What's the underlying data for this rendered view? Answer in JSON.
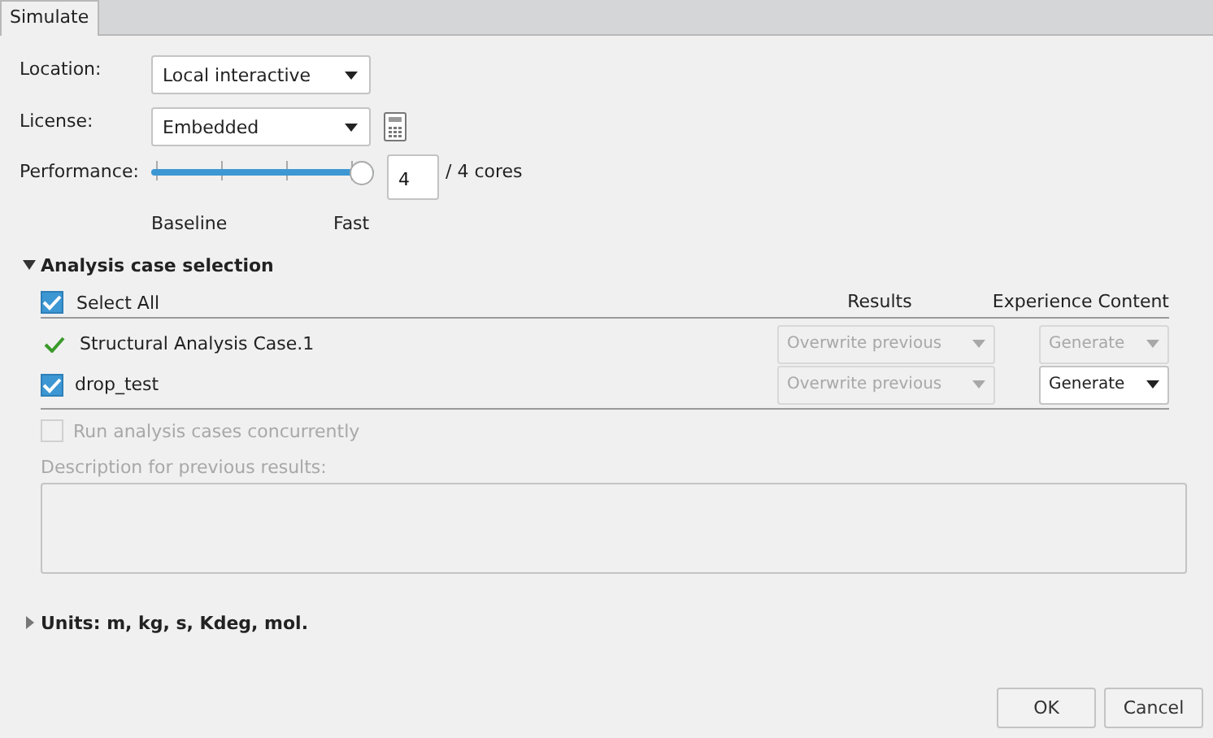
{
  "tabs": [
    {
      "label": "Simulate",
      "selected": true
    }
  ],
  "location": {
    "label": "Location:",
    "value": "Local interactive"
  },
  "license": {
    "label": "License:",
    "value": "Embedded"
  },
  "performance": {
    "label": "Performance:",
    "level": 1,
    "cores": "4",
    "cores_suffix": "/ 4 cores",
    "min_label": "Baseline",
    "max_label": "Fast"
  },
  "analysis": {
    "title": "Analysis case selection",
    "expanded": true,
    "select_all": {
      "label": "Select All",
      "checked": true
    },
    "columns": [
      "Results",
      "Experience Content"
    ],
    "rows": [
      {
        "kind": "status",
        "name": "Structural Analysis Case.1",
        "results": {
          "value": "Overwrite previous",
          "disabled": true
        },
        "content": {
          "value": "Generate",
          "disabled": true
        }
      },
      {
        "kind": "checkbox",
        "checked": true,
        "name": "drop_test",
        "results": {
          "value": "Overwrite previous",
          "disabled": true
        },
        "content": {
          "value": "Generate",
          "disabled": false
        }
      }
    ],
    "concurrent": {
      "label": "Run analysis cases concurrently",
      "checked": false,
      "disabled": true
    },
    "description_label": "Description for previous results:"
  },
  "units": {
    "title": "Units: m, kg, s, Kdeg, mol.",
    "expanded": false
  },
  "buttons": [
    "OK",
    "Cancel"
  ]
}
